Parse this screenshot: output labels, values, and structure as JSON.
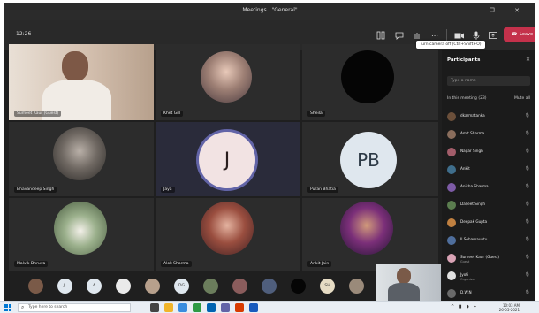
{
  "window": {
    "title": "Meetings | \"General\"",
    "controls": "—  ❐  ✕"
  },
  "toolbar": {
    "timer": "12:26",
    "leave_label": "Leave",
    "tooltip": "Turn camera off (Ctrl+Shift+O)"
  },
  "tiles": [
    {
      "name": "Sumeet Kaur (Guest)"
    },
    {
      "name": "Khet Gill"
    },
    {
      "name": "Sheila"
    },
    {
      "name": "Bhavandeep Singh"
    },
    {
      "name": "Jaya",
      "initials": "J"
    },
    {
      "name": "Puran Bhatia",
      "initials": "PB"
    },
    {
      "name": "Malvik Dhruva"
    },
    {
      "name": "Alok Sharma"
    },
    {
      "name": "Ankit Jain"
    }
  ],
  "strip": {
    "initials": [
      "",
      "JL",
      "A",
      "",
      "",
      "DG",
      "",
      "",
      "",
      "",
      "SH",
      ""
    ]
  },
  "participants": {
    "title": "Participants",
    "close": "✕",
    "search_placeholder": "Type a name",
    "section_label": "In this meeting (23)",
    "mute_all": "Mute all",
    "people": [
      {
        "name": "dkarmatanka",
        "sub": "",
        "color": "#6b4f3a"
      },
      {
        "name": "Amit Sharma",
        "sub": "",
        "color": "#8a6d5c"
      },
      {
        "name": "Nagar Singh",
        "sub": "",
        "color": "#a35d6a"
      },
      {
        "name": "Ankit",
        "sub": "",
        "color": "#3f6e8c"
      },
      {
        "name": "Anisha Sharma",
        "sub": "",
        "color": "#7d5ba6"
      },
      {
        "name": "Daljeet Singh",
        "sub": "",
        "color": "#5b7d4f"
      },
      {
        "name": "Deepak Gupta",
        "sub": "",
        "color": "#c08040"
      },
      {
        "name": "Il Sohamauntu",
        "sub": "",
        "color": "#4f6e9c"
      },
      {
        "name": "Sumeet Kaur (Guest)",
        "sub": "Guest",
        "color": "#d9a3b5"
      },
      {
        "name": "Jyoti",
        "sub": "Organizer",
        "color": "#e0e0e0"
      },
      {
        "name": "D.W.N",
        "sub": "",
        "color": "#6a6a6a"
      }
    ]
  },
  "taskbar": {
    "search_placeholder": "Type here to search",
    "time": "10:03 AM",
    "date": "26-05-2021"
  },
  "colors": {
    "accent": "#6264a7",
    "leave": "#c4314b",
    "tile_bg": "#2c2c2c"
  }
}
